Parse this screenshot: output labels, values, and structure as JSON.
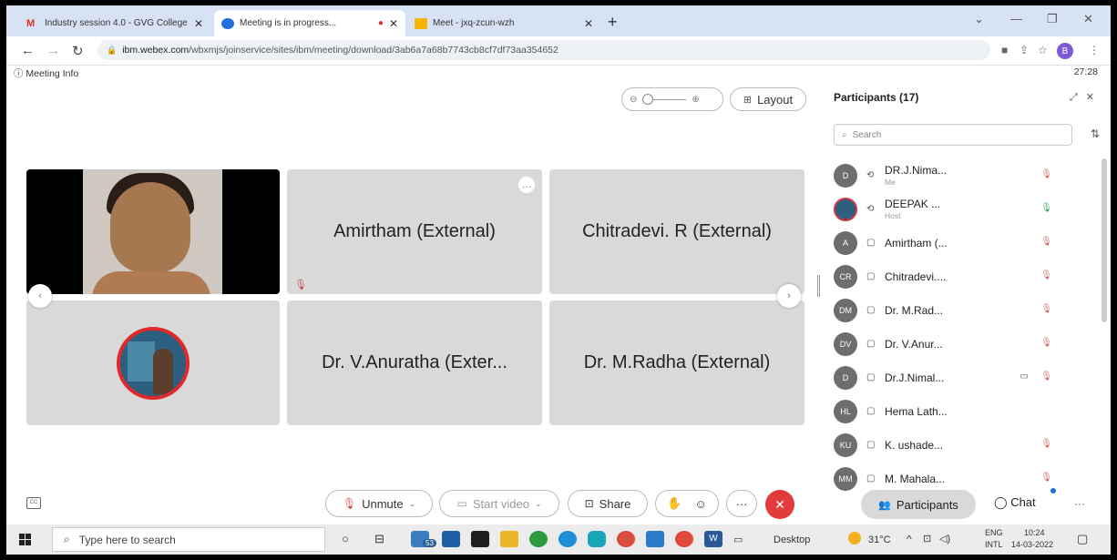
{
  "browser": {
    "tabs": [
      {
        "title": "Industry session 4.0 - GVG College",
        "icon": "gmail-icon",
        "color": "#d93025"
      },
      {
        "title": "Meeting is in progress...",
        "icon": "webex-icon",
        "color": "#1e6fd9",
        "active": true
      },
      {
        "title": "Meet - jxq-zcun-wzh",
        "icon": "meet-icon",
        "color": "#f4b400"
      }
    ],
    "url_domain": "ibm.webex.com",
    "url_path": "/wbxmjs/joinservice/sites/ibm/meeting/download/3ab6a7a68b7743cb8cf7df73aa354652",
    "profile_initial": "B"
  },
  "meeting": {
    "info_label": "Meeting Info",
    "timer": "27:28",
    "layout_label": "Layout",
    "tiles": [
      {
        "name": "",
        "type": "video"
      },
      {
        "name": "Amirtham (External)",
        "muted": true
      },
      {
        "name": "Chitradevi. R (External)"
      },
      {
        "name": "",
        "type": "avatar"
      },
      {
        "name": "Dr. V.Anuratha (Exter..."
      },
      {
        "name": "Dr. M.Radha (External)"
      }
    ]
  },
  "participants": {
    "title": "Participants (17)",
    "search_placeholder": "Search",
    "list": [
      {
        "initials": "D",
        "name": "DR.J.Nima...",
        "sub": "Me",
        "device": "sync",
        "mic": "muted"
      },
      {
        "initials": "",
        "name": "DEEPAK ...",
        "sub": "Host",
        "device": "sync",
        "mic": "on",
        "photo": true
      },
      {
        "initials": "A",
        "name": "Amirtham (...",
        "sub": "",
        "device": "web",
        "mic": "muted"
      },
      {
        "initials": "CR",
        "name": "Chitradevi....",
        "sub": "",
        "device": "web",
        "mic": "muted"
      },
      {
        "initials": "DM",
        "name": "Dr. M.Rad...",
        "sub": "",
        "device": "web",
        "mic": "muted"
      },
      {
        "initials": "DV",
        "name": "Dr. V.Anur...",
        "sub": "",
        "device": "web",
        "mic": "muted"
      },
      {
        "initials": "D",
        "name": "Dr.J.Nimal...",
        "sub": "",
        "device": "web",
        "mic": "muted",
        "camera": true
      },
      {
        "initials": "HL",
        "name": "Hema Lath...",
        "sub": "",
        "device": "web",
        "mic": "none"
      },
      {
        "initials": "KU",
        "name": "K. ushade...",
        "sub": "",
        "device": "web",
        "mic": "muted"
      },
      {
        "initials": "MM",
        "name": "M. Mahala...",
        "sub": "",
        "device": "web",
        "mic": "muted"
      }
    ]
  },
  "controls": {
    "unmute": "Unmute",
    "start_video": "Start video",
    "share": "Share",
    "participants": "Participants",
    "chat": "Chat"
  },
  "taskbar": {
    "search_placeholder": "Type here to search",
    "badge": "53",
    "desktop": "Desktop",
    "temperature": "31°C",
    "lang1": "ENG",
    "lang2": "INTL",
    "time": "10:24",
    "date": "14-03-2022"
  }
}
